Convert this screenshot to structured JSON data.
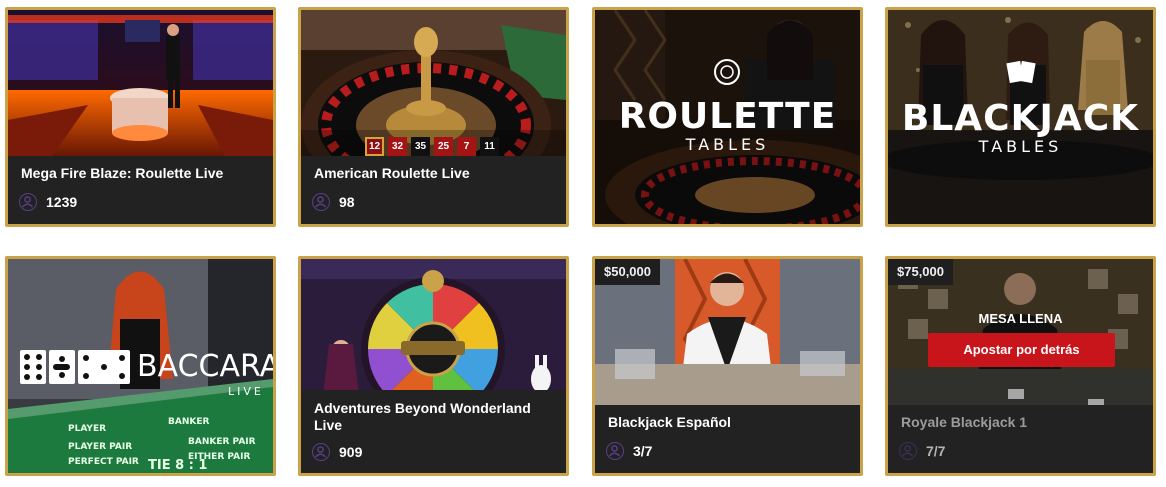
{
  "cards": [
    {
      "title": "Mega Fire Blaze: Roulette Live",
      "players": "1239"
    },
    {
      "title": "American Roulette Live",
      "players": "98",
      "numbers": [
        "12",
        "32",
        "35",
        "25",
        "7",
        "11"
      ]
    },
    {
      "logo_main": "ROULETTE",
      "logo_sub": "TABLES"
    },
    {
      "logo_main": "BLACKJACK",
      "logo_sub": "TABLES"
    },
    {
      "logo_main": "BACCARAT",
      "logo_sub": "LIVE"
    },
    {
      "title": "Adventures Beyond Wonderland Live",
      "players": "909"
    },
    {
      "title": "Blackjack Español",
      "players": "3/7",
      "min_bet": "$50,000"
    },
    {
      "title": "Royale Blackjack 1",
      "players": "7/7",
      "min_bet": "$75,000",
      "status": "MESA LLENA",
      "action": "Apostar por detrás"
    }
  ],
  "icons": {
    "players": "user-icon"
  },
  "colors": {
    "border": "#c9a24a",
    "bet_behind": "#c8141b",
    "icon": "#5a3f8a",
    "info_bg": "#222222"
  }
}
